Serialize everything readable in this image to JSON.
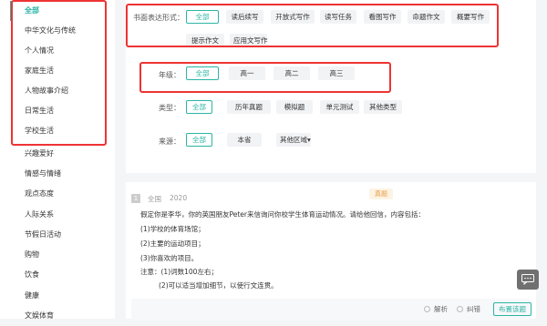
{
  "sidebar": {
    "items": [
      {
        "label": "全部",
        "active": true
      },
      {
        "label": "中华文化与传统"
      },
      {
        "label": "个人情况"
      },
      {
        "label": "家庭生活"
      },
      {
        "label": "人物故事介绍"
      },
      {
        "label": "日常生活"
      },
      {
        "label": "学校生活"
      },
      {
        "label": "兴趣爱好"
      },
      {
        "label": "情感与情绪"
      },
      {
        "label": "观点态度"
      },
      {
        "label": "人际关系"
      },
      {
        "label": "节假日活动"
      },
      {
        "label": "购物"
      },
      {
        "label": "饮食"
      },
      {
        "label": "健康"
      },
      {
        "label": "文娱体育"
      }
    ]
  },
  "filters": {
    "form": {
      "label": "书面表达形式：",
      "options": [
        "全部",
        "读后续写",
        "开放式写作",
        "读写任务",
        "看图写作",
        "命题作文",
        "概要写作",
        "提示作文",
        "应用文写作"
      ]
    },
    "grade": {
      "label": "年级：",
      "options": [
        "全部",
        "高一",
        "高二",
        "高三"
      ]
    },
    "type": {
      "label": "类型：",
      "options": [
        "全部",
        "历年真题",
        "模拟题",
        "单元测试",
        "其他类型"
      ]
    },
    "source": {
      "label": "来源：",
      "options": [
        "全部",
        "本省",
        "其他区域▾"
      ]
    }
  },
  "question": {
    "number": "1",
    "region": "全国",
    "year": "2020",
    "badge": "真题",
    "lines": [
      "假定你是李华，你的英国朋友Peter来信询问你校学生体育运动情况。请给他回信，内容包括：",
      "(1)学校的体育场馆；",
      "(2)主要的运动项目；",
      "(3)你喜欢的项目。",
      "注意：(1)词数100左右；",
      "(2)可以适当增加细节，以使行文连贯。"
    ],
    "footer": {
      "analysis": "解析",
      "report": "纠错",
      "assign": "布置该题"
    }
  },
  "colors": {
    "accent": "#2bb5a4",
    "highlight_box": "#ee3333",
    "badge_bg": "#fdf3e4",
    "badge_text": "#e89a3c"
  },
  "icons": {
    "chat": "chat-bubble-icon",
    "report": "circle-icon"
  }
}
